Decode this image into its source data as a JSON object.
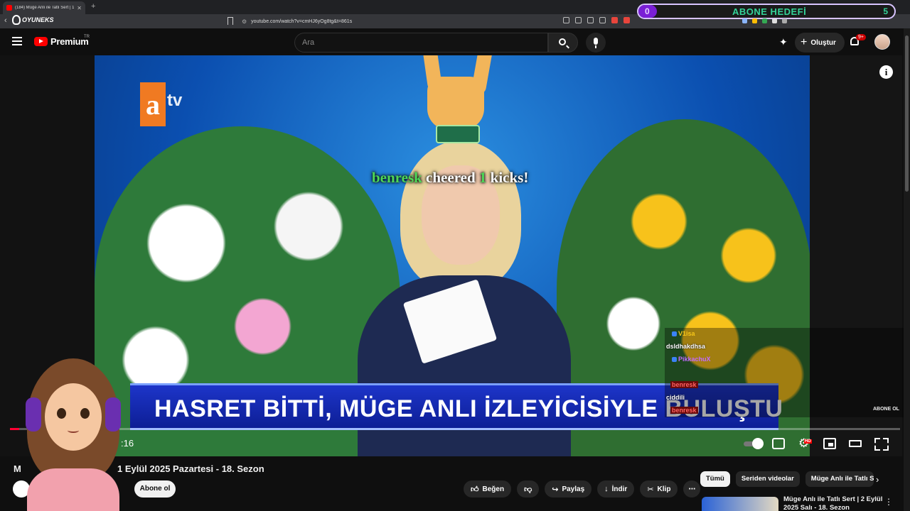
{
  "browser": {
    "tab_title": "(184) Müge Anlı ile Tatlı Sert | 1 ...",
    "url": "youtube.com/watch?v=cmHJ6yOg8tg&t=861s",
    "overlay_logo": "OYUNEKS"
  },
  "goal_overlay": {
    "current": "0",
    "label": "ABONE HEDEFİ",
    "target": "5",
    "progress_fraction": 0
  },
  "header": {
    "brand": "Premium",
    "country": "TR",
    "search_placeholder": "Ara",
    "create_label": "Oluştur",
    "notifications": "9+"
  },
  "video": {
    "channel_logo": "a",
    "channel_logo_suffix": "tv",
    "cheer": {
      "user": "benresk",
      "word1": "cheered",
      "amount": "1",
      "word2": "kicks!"
    },
    "chyron": "HASRET BİTTİ, MÜGE ANLI İZLEYİCİSİYLE BULUŞTU",
    "time": ":16",
    "progress_fraction": 0.01
  },
  "chat": [
    {
      "name": "V1isa",
      "message": "dsldhakdhsa"
    },
    {
      "name": "PikkachuX",
      "message": ""
    },
    {
      "name": "benresk",
      "message": "ciddili"
    },
    {
      "name": "benresk",
      "message": ""
    }
  ],
  "stream_overlay": {
    "text": "ABONE OL"
  },
  "below": {
    "title_visible": "M",
    "title_rest": "1 Eylül 2025 Pazartesi - 18. Sezon",
    "subscribe": "Abone ol",
    "actions": [
      "Beğen",
      "",
      "Paylaş",
      "İndir",
      "Klip"
    ]
  },
  "chips": [
    "Tümü",
    "Seriden videolar",
    "Müge Anlı ile Tatlı Ser"
  ],
  "recommendation": {
    "title": "Müge Anlı ile Tatlı Sert | 2 Eylül 2025 Salı - 18. Sezon"
  }
}
